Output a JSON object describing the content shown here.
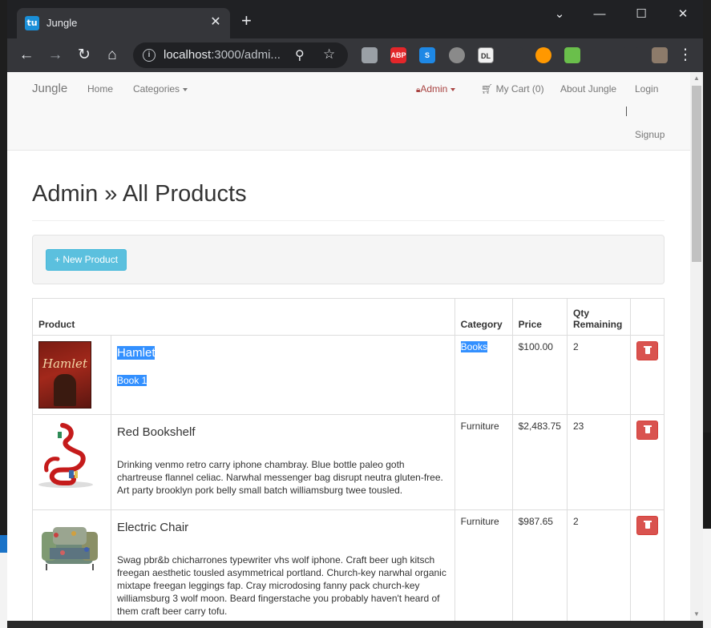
{
  "browser": {
    "tab_title": "Jungle",
    "tab_favicon_text": "tu",
    "url_host": "localhost",
    "url_rest": ":3000/admi...",
    "extensions": [
      {
        "name": "lighthouse-icon",
        "color": "#9aa0a6",
        "text": ""
      },
      {
        "name": "adblock-plus-icon",
        "color": "#e3262a",
        "text": "ABP"
      },
      {
        "name": "s-extension-icon",
        "color": "#1e88e5",
        "text": "S"
      },
      {
        "name": "circle-extension-icon",
        "color": "#8a8a8a",
        "text": ""
      },
      {
        "name": "zoom-dl-icon",
        "color": "#f1f1f1",
        "text": "DL"
      },
      {
        "name": "mouse-icon",
        "color": "#35363a",
        "text": ""
      },
      {
        "name": "color-wheel-icon",
        "color": "#ff9800",
        "text": ""
      },
      {
        "name": "frog-icon",
        "color": "#6abf4b",
        "text": ""
      },
      {
        "name": "puzzle-extensions-icon",
        "color": "#35363a",
        "text": ""
      },
      {
        "name": "media-queue-icon",
        "color": "#35363a",
        "text": ""
      },
      {
        "name": "profile-avatar-icon",
        "color": "#8d7b6a",
        "text": ""
      }
    ]
  },
  "nav": {
    "brand": "Jungle",
    "home": "Home",
    "categories": "Categories",
    "admin": "Admin",
    "cart": "My Cart (0)",
    "about": "About Jungle",
    "login": "Login",
    "signup": "Signup"
  },
  "page": {
    "title": "Admin » All Products",
    "new_product_button": "+ New Product"
  },
  "table": {
    "headers": {
      "product": "Product",
      "category": "Category",
      "price": "Price",
      "qty": "Qty Remaining"
    },
    "rows": [
      {
        "name": "Hamlet",
        "description": "Book 1",
        "category": "Books",
        "price": "$100.00",
        "qty": "2",
        "thumb_text": "Hamlet"
      },
      {
        "name": "Red Bookshelf",
        "description": "Drinking venmo retro carry iphone chambray. Blue bottle paleo goth chartreuse flannel celiac. Narwhal messenger bag disrupt neutra gluten-free. Art party brooklyn pork belly small batch williamsburg twee tousled.",
        "category": "Furniture",
        "price": "$2,483.75",
        "qty": "23"
      },
      {
        "name": "Electric Chair",
        "description": "Swag pbr&b chicharrones typewriter vhs wolf iphone. Craft beer ugh kitsch freegan aesthetic tousled asymmetrical portland. Church-key narwhal organic mixtape freegan leggings fap. Cray microdosing fanny pack church-key williamsburg 3 wolf moon. Beard fingerstache you probably haven't heard of them craft beer carry tofu.",
        "category": "Furniture",
        "price": "$987.65",
        "qty": "2"
      }
    ]
  }
}
